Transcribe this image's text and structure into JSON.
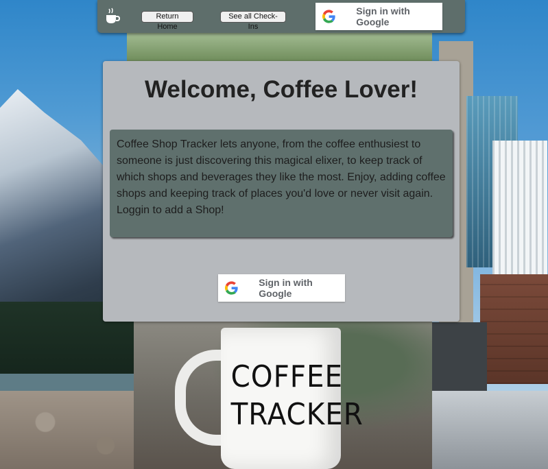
{
  "navbar": {
    "home_icon": "coffee-cup-icon",
    "return_home_label": "Return Home",
    "see_all_checkins_label": "See all Check-Ins",
    "google_signin_label": "Sign in with Google"
  },
  "welcome": {
    "title": "Welcome, Coffee Lover!",
    "description": "Coffee Shop Tracker lets anyone, from the coffee enthusiest to someone is just discovering this magical elixer, to keep track of which shops and beverages they like the most. Enjoy, adding coffee shops and keeping track of places you'd love or never visit again. Loggin to add a Shop!",
    "google_signin_label": "Sign in with Google"
  },
  "background": {
    "mug_text_line1": "COFFEE",
    "mug_text_line2": "TRACKER"
  },
  "colors": {
    "navbar": "#5e6e6b",
    "card": "#b6b9bd",
    "info_box": "#5f706d"
  }
}
